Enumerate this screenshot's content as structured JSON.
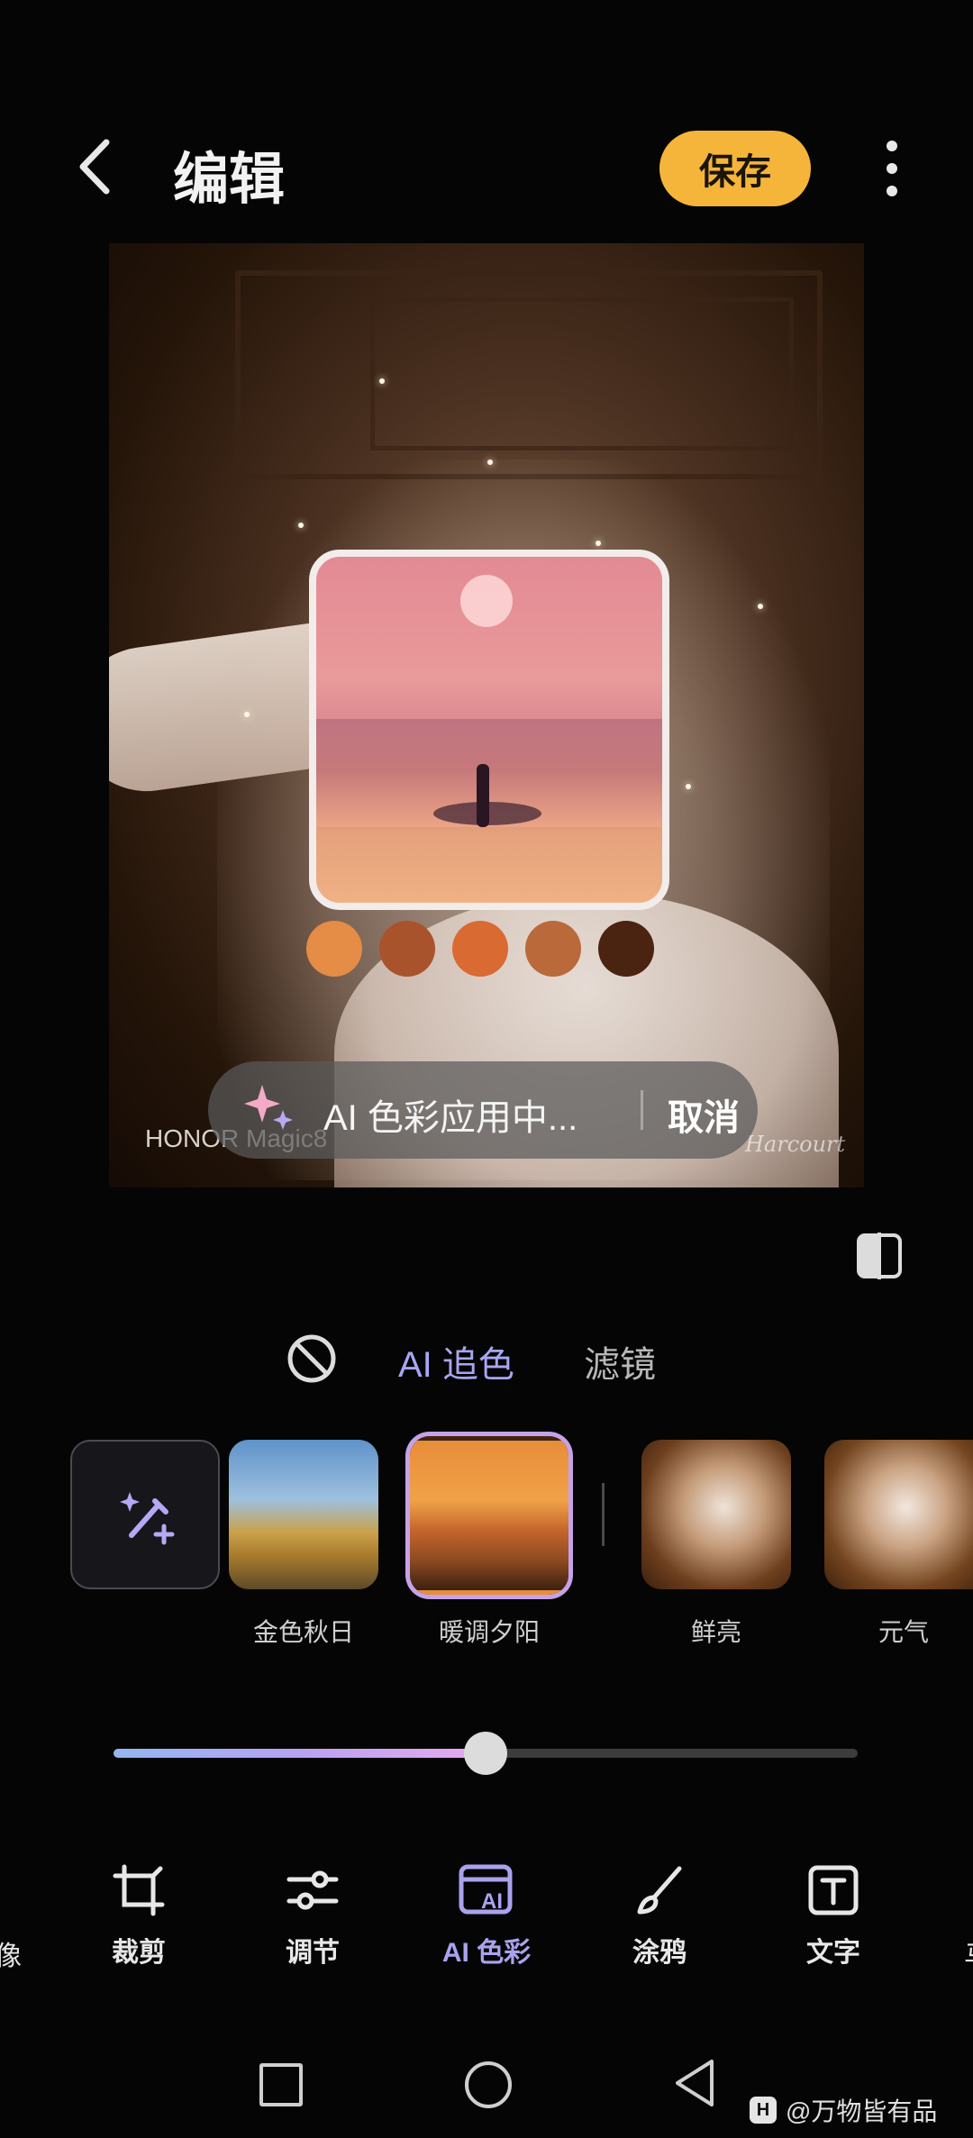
{
  "header": {
    "title": "编辑",
    "save_label": "保存"
  },
  "photo": {
    "device_watermark": "HONOR Magic8",
    "signature": "Harcourt",
    "palette": [
      "#e58c47",
      "#a9532d",
      "#d86a32",
      "#b9693a",
      "#4a2411"
    ]
  },
  "ai_status": {
    "text": "AI 色彩应用中...",
    "cancel_label": "取消"
  },
  "modes": {
    "ai_chase": "AI 追色",
    "filter": "滤镜"
  },
  "filters": [
    {
      "label": "金色秋日"
    },
    {
      "label": "暖调夕阳",
      "selected": true
    },
    {
      "label": "鲜亮"
    },
    {
      "label": "元气"
    }
  ],
  "slider": {
    "value": 0.5
  },
  "toolbar": {
    "left_edge": "像",
    "right_edge": "马",
    "items": [
      {
        "label": "裁剪",
        "icon": "crop-icon"
      },
      {
        "label": "调节",
        "icon": "adjust-icon"
      },
      {
        "label": "AI 色彩",
        "icon": "ai-color-icon",
        "active": true
      },
      {
        "label": "涂鸦",
        "icon": "brush-icon"
      },
      {
        "label": "文字",
        "icon": "text-icon"
      }
    ]
  },
  "credit": {
    "badge": "H",
    "text": "@万物皆有品"
  },
  "colors": {
    "accent": "#f5b53a",
    "ai": "#a7a6f5"
  }
}
